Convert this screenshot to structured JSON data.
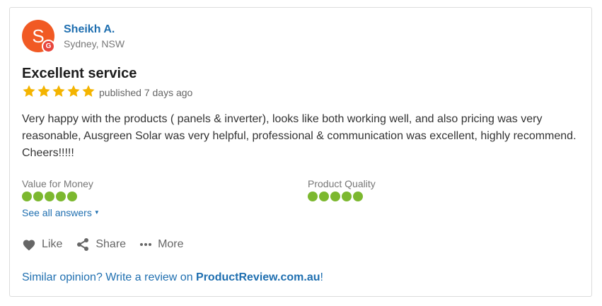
{
  "colors": {
    "avatar_bg": "#f15a24",
    "google_badge_bg": "#e8453c",
    "star": "#f4b400",
    "rating_dot": "#7cb82f",
    "link": "#1f6fb0"
  },
  "reviewer": {
    "avatar_letter": "S",
    "badge_letter": "G",
    "name": "Sheikh A.",
    "location": "Sydney, NSW"
  },
  "review": {
    "title": "Excellent service",
    "star_rating": 5,
    "published": "published 7 days ago",
    "body": "Very happy with the products ( panels & inverter), looks like both working well, and also pricing was very reasonable, Ausgreen Solar was very helpful, professional & communication was excellent, highly recommend. Cheers!!!!!"
  },
  "ratings": [
    {
      "label": "Value for Money",
      "score": 5
    },
    {
      "label": "Product Quality",
      "score": 5
    }
  ],
  "see_all": {
    "label": "See all answers",
    "icon": "caret-down-icon"
  },
  "actions": [
    {
      "label": "Like",
      "icon": "heart-icon"
    },
    {
      "label": "Share",
      "icon": "share-icon"
    },
    {
      "label": "More",
      "icon": "more-dots-icon"
    }
  ],
  "cta": {
    "prefix": "Similar opinion? Write a review on ",
    "link": "ProductReview.com.au",
    "suffix": "!"
  }
}
